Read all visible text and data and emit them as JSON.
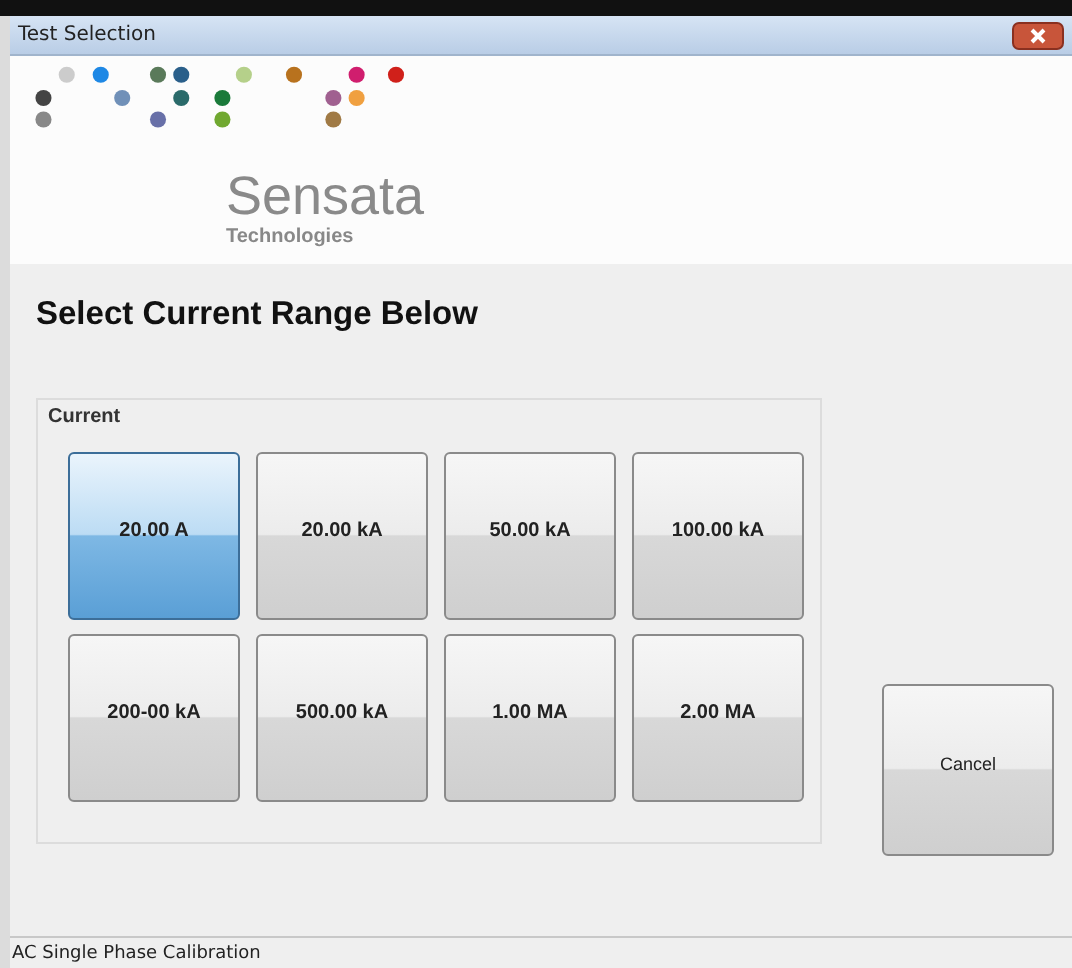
{
  "window": {
    "title": "Test Selection"
  },
  "logo": {
    "name": "Sensata",
    "subtitle": "Technologies"
  },
  "heading": "Select Current Range Below",
  "group": {
    "label": "Current",
    "buttons": [
      {
        "label": "20.00 A",
        "selected": true
      },
      {
        "label": "20.00 kA",
        "selected": false
      },
      {
        "label": "50.00 kA",
        "selected": false
      },
      {
        "label": "100.00 kA",
        "selected": false
      },
      {
        "label": "200-00 kA",
        "selected": false
      },
      {
        "label": "500.00 kA",
        "selected": false
      },
      {
        "label": "1.00 MA",
        "selected": false
      },
      {
        "label": "2.00 MA",
        "selected": false
      }
    ]
  },
  "cancel_button": "Cancel",
  "status_bar": "AC Single Phase Calibration"
}
